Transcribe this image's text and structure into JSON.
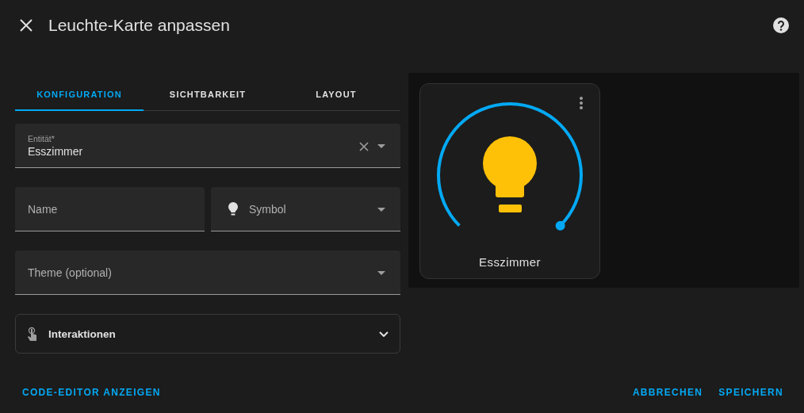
{
  "dialog": {
    "title": "Leuchte-Karte anpassen"
  },
  "tabs": [
    {
      "label": "KONFIGURATION",
      "selected": true
    },
    {
      "label": "SICHTBARKEIT",
      "selected": false
    },
    {
      "label": "LAYOUT",
      "selected": false
    }
  ],
  "entity_field": {
    "label": "Entität*",
    "value": "Esszimmer"
  },
  "name_field": {
    "placeholder": "Name"
  },
  "icon_field": {
    "placeholder": "Symbol"
  },
  "theme_field": {
    "placeholder": "Theme (optional)"
  },
  "interactions": {
    "label": "Interaktionen",
    "expanded": false
  },
  "preview": {
    "name": "Esszimmer"
  },
  "footer": {
    "code_editor": "CODE-EDITOR ANZEIGEN",
    "cancel": "ABBRECHEN",
    "save": "SPEICHERN"
  }
}
